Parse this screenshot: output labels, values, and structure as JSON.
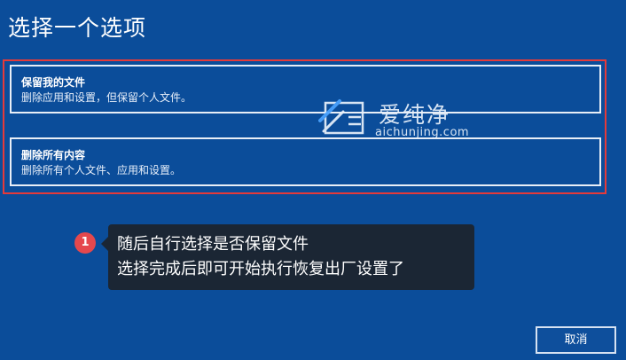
{
  "page": {
    "title": "选择一个选项"
  },
  "options": [
    {
      "title": "保留我的文件",
      "description": "删除应用和设置，但保留个人文件。"
    },
    {
      "title": "删除所有内容",
      "description": "删除所有个人文件、应用和设置。"
    }
  ],
  "watermark": {
    "name": "爱纯净",
    "url": "aichunjing.com"
  },
  "annotation": {
    "step": "1",
    "lines": [
      "随后自行选择是否保留文件",
      "选择完成后即可开始执行恢复出厂设置了"
    ]
  },
  "footer": {
    "cancel_label": "取消"
  },
  "colors": {
    "background": "#0b4d9a",
    "highlight": "#e53a3a",
    "badge": "#e5484d",
    "tooltip": "#1b2634"
  }
}
